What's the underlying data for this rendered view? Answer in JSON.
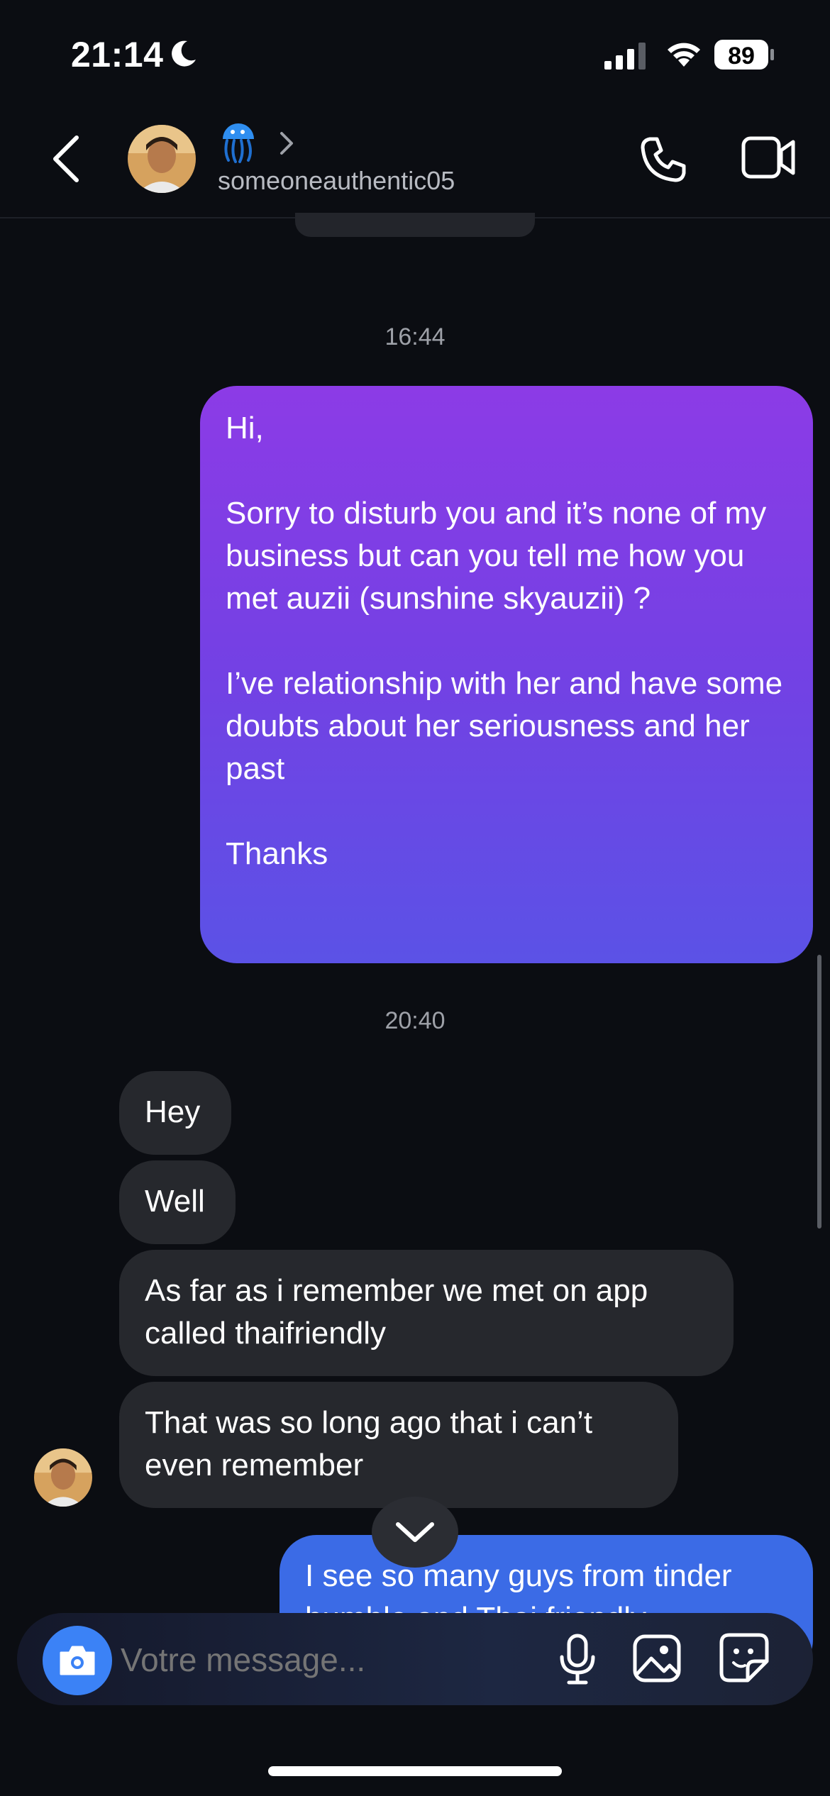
{
  "status_bar": {
    "time": "21:14",
    "battery": "89"
  },
  "header": {
    "contact_username": "someoneauthentic05",
    "icons": [
      "back-arrow-icon",
      "avatar",
      "jellyfish-emoji-icon",
      "chevron-right-icon",
      "phone-icon",
      "video-camera-icon"
    ]
  },
  "conversation": {
    "timestamp_1": "16:44",
    "sent_message_1": {
      "line_1": "Hi,",
      "line_2": "Sorry to disturb you and it’s none of my business but can you tell me how you met auzii (sunshine skyauzii) ?",
      "line_3": "I’ve relationship with her and have some doubts about her seriousness and her past",
      "line_4": "Thanks"
    },
    "timestamp_2": "20:40",
    "received": [
      "Hey",
      "Well",
      "As far as i remember we met on app called thaifriendly",
      "That was so long ago that i can’t even remember"
    ],
    "sent_message_2": "I see so many guys from tinder bumble and Thai friendly"
  },
  "composer": {
    "placeholder": "Votre message..."
  },
  "colors": {
    "background": "#0b0d12",
    "sent_gradient_top": "#8c3be6",
    "sent_gradient_bottom": "#5b52e6",
    "sent_blue": "#3b6be6",
    "received_bubble": "#26282d",
    "camera_button": "#3b82f6"
  }
}
